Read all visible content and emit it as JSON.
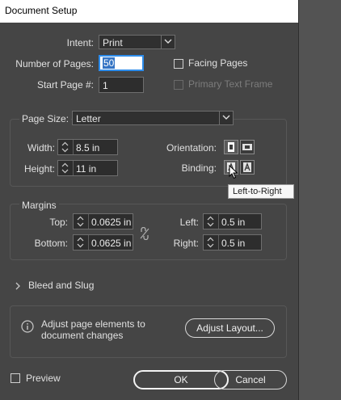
{
  "window": {
    "title": "Document Setup"
  },
  "document": {
    "intent_label": "Intent:",
    "intent_value": "Print",
    "pages_label": "Number of Pages:",
    "pages_value": "50",
    "facing_label": "Facing Pages",
    "facing_checked": false,
    "start_label": "Start Page #:",
    "start_value": "1",
    "primary_label": "Primary Text Frame",
    "primary_checked": false
  },
  "page_size": {
    "label": "Page Size:",
    "value": "Letter",
    "width_label": "Width:",
    "width_value": "8.5 in",
    "height_label": "Height:",
    "height_value": "11 in",
    "orientation_label": "Orientation:",
    "binding_label": "Binding:",
    "tooltip": "Left-to-Right"
  },
  "margins": {
    "heading": "Margins",
    "top_label": "Top:",
    "top_value": "0.0625 in",
    "bottom_label": "Bottom:",
    "bottom_value": "0.0625 in",
    "left_label": "Left:",
    "left_value": "0.5 in",
    "right_label": "Right:",
    "right_value": "0.5 in"
  },
  "bleed": {
    "label": "Bleed and Slug"
  },
  "adjust": {
    "message_line1": "Adjust page elements to",
    "message_line2": "document changes",
    "button": "Adjust Layout..."
  },
  "footer": {
    "preview_label": "Preview",
    "ok": "OK",
    "cancel": "Cancel"
  },
  "icons": {
    "chevron": "chevron-down-icon",
    "stepper": "stepper-icon",
    "portrait": "portrait-icon",
    "landscape": "landscape-icon",
    "binding_ltr": "binding-left-to-right-icon",
    "binding_rtl": "binding-right-to-left-icon",
    "link": "link-broken-icon",
    "info": "info-icon",
    "disclosure": "disclosure-triangle-icon",
    "cursor": "cursor-icon"
  },
  "colors": {
    "dialog_bg": "#454545",
    "page_bg": "#535353",
    "field_bg": "#2d2d2d",
    "focus_border": "#2d8ceb",
    "selection": "#3474c4"
  }
}
